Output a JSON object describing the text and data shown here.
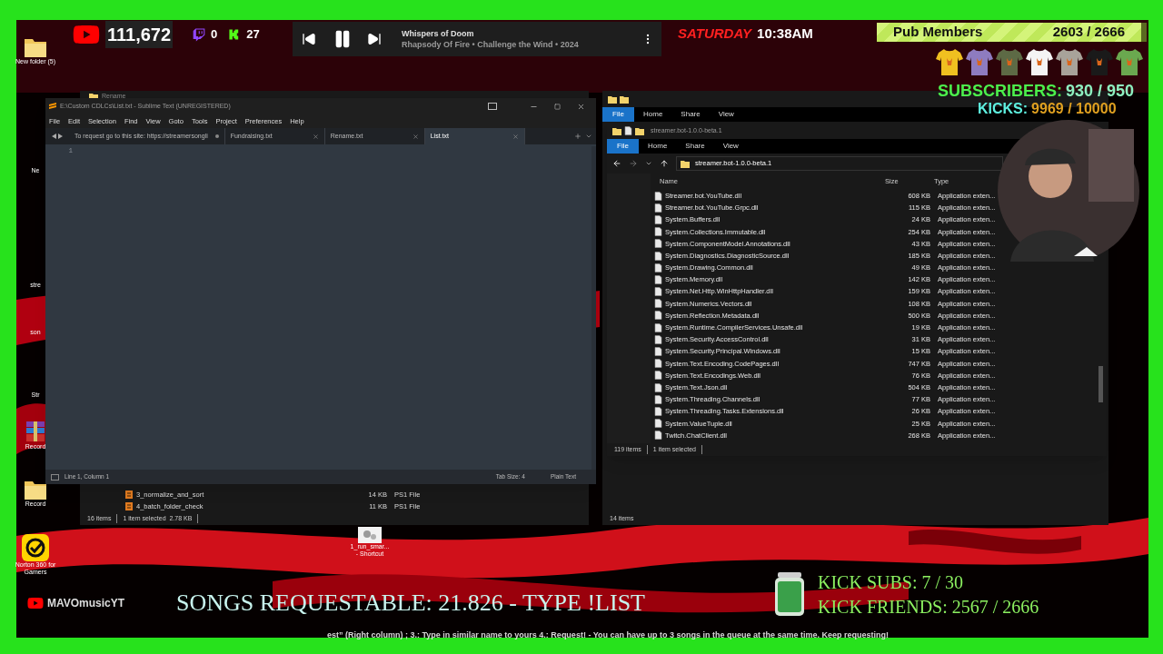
{
  "overlay_top": {
    "youtube_count": "111,672",
    "twitch_count": "0",
    "kick_count": "27",
    "now_playing": {
      "title": "Whispers of Doom",
      "subtitle": "Rhapsody Of Fire • Challenge the Wind • 2024",
      "playing": true
    },
    "day": "SATURDAY",
    "time": "10:38AM",
    "pub_members": {
      "label": "Pub Members",
      "count": "2603 / 2666",
      "level": 0.98
    },
    "shirts": [
      {
        "color": "#f0c020"
      },
      {
        "color": "#8e7cc0"
      },
      {
        "color": "#5d6a45"
      },
      {
        "color": "#f4f4f4"
      },
      {
        "color": "#a8a39a"
      },
      {
        "color": "#1a1a1a"
      },
      {
        "color": "#6aa84f"
      }
    ],
    "subscribers": {
      "label": "SUBSCRIBERS:",
      "count": "930 / 950"
    },
    "kicks": {
      "label": "KICKS:",
      "count": "9969 / 10000"
    }
  },
  "desktop_icons": [
    {
      "label": "New folder (5)",
      "kind": "folder"
    },
    {
      "label": "Ne",
      "kind": "partial"
    },
    {
      "label": "stre",
      "kind": "partial"
    },
    {
      "label": "son",
      "kind": "partial"
    },
    {
      "label": "Str",
      "kind": "partial"
    },
    {
      "label": "Record",
      "kind": "archive"
    },
    {
      "label": "Record",
      "kind": "folder"
    },
    {
      "label": "Norton 360 for Gamers",
      "kind": "norton"
    }
  ],
  "shortcut": {
    "label": "1_run_smar... - Shortcut"
  },
  "rename_window": {
    "title": "Rename",
    "rows": [
      {
        "name": "3_normalize_and_sort",
        "size": "14 KB",
        "type": "PS1 File"
      },
      {
        "name": "4_batch_folder_check",
        "size": "11 KB",
        "type": "PS1 File"
      }
    ],
    "status": [
      "16 items",
      "1 item selected  2.78 KB"
    ]
  },
  "sublime": {
    "title": "E:\\Custom CDLCs\\List.txt - Sublime Text (UNREGISTERED)",
    "menu": [
      "File",
      "Edit",
      "Selection",
      "Find",
      "View",
      "Goto",
      "Tools",
      "Project",
      "Preferences",
      "Help"
    ],
    "tabs": [
      {
        "label": "To request go to this site: https://streamersongli",
        "selected": false,
        "dirty": true
      },
      {
        "label": "Fundraising.txt",
        "selected": false,
        "dirty": false
      },
      {
        "label": "Rename.txt",
        "selected": false,
        "dirty": false
      },
      {
        "label": "List.txt",
        "selected": true,
        "dirty": false
      }
    ],
    "line_numbers": [
      "1"
    ],
    "status": "Line 1, Column 1",
    "tab_size": "Tab Size: 4",
    "syntax": "Plain Text"
  },
  "explorer_back": {
    "ribbon": [
      {
        "label": "File",
        "selected": true
      },
      {
        "label": "Home",
        "selected": false
      },
      {
        "label": "Share",
        "selected": false
      },
      {
        "label": "View",
        "selected": false
      }
    ],
    "status": "14 items"
  },
  "explorer": {
    "title": "streamer.bot-1.0.0-beta.1",
    "ribbon": [
      {
        "label": "File",
        "selected": true
      },
      {
        "label": "Home",
        "selected": false
      },
      {
        "label": "Share",
        "selected": false
      },
      {
        "label": "View",
        "selected": false
      }
    ],
    "path": "streamer.bot-1.0.0-beta.1",
    "columns": [
      "Name",
      "Size",
      "Type"
    ],
    "rows": [
      {
        "name": "Streamer.bot.YouTube.dll",
        "size": "608 KB",
        "type": "Application exten..."
      },
      {
        "name": "Streamer.bot.YouTube.Grpc.dll",
        "size": "115 KB",
        "type": "Application exten..."
      },
      {
        "name": "System.Buffers.dll",
        "size": "24 KB",
        "type": "Application exten..."
      },
      {
        "name": "System.Collections.Immutable.dll",
        "size": "254 KB",
        "type": "Application exten..."
      },
      {
        "name": "System.ComponentModel.Annotations.dll",
        "size": "43 KB",
        "type": "Application exten..."
      },
      {
        "name": "System.Diagnostics.DiagnosticSource.dll",
        "size": "185 KB",
        "type": "Application exten..."
      },
      {
        "name": "System.Drawing.Common.dll",
        "size": "49 KB",
        "type": "Application exten..."
      },
      {
        "name": "System.Memory.dll",
        "size": "142 KB",
        "type": "Application exten..."
      },
      {
        "name": "System.Net.Http.WinHttpHandler.dll",
        "size": "159 KB",
        "type": "Application exten..."
      },
      {
        "name": "System.Numerics.Vectors.dll",
        "size": "108 KB",
        "type": "Application exten..."
      },
      {
        "name": "System.Reflection.Metadata.dll",
        "size": "500 KB",
        "type": "Application exten..."
      },
      {
        "name": "System.Runtime.CompilerServices.Unsafe.dll",
        "size": "19 KB",
        "type": "Application exten..."
      },
      {
        "name": "System.Security.AccessControl.dll",
        "size": "31 KB",
        "type": "Application exten..."
      },
      {
        "name": "System.Security.Principal.Windows.dll",
        "size": "15 KB",
        "type": "Application exten..."
      },
      {
        "name": "System.Text.Encoding.CodePages.dll",
        "size": "747 KB",
        "type": "Application exten..."
      },
      {
        "name": "System.Text.Encodings.Web.dll",
        "size": "76 KB",
        "type": "Application exten..."
      },
      {
        "name": "System.Text.Json.dll",
        "size": "504 KB",
        "type": "Application exten..."
      },
      {
        "name": "System.Threading.Channels.dll",
        "size": "77 KB",
        "type": "Application exten..."
      },
      {
        "name": "System.Threading.Tasks.Extensions.dll",
        "size": "26 KB",
        "type": "Application exten..."
      },
      {
        "name": "System.ValueTuple.dll",
        "size": "25 KB",
        "type": "Application exten..."
      },
      {
        "name": "Twitch.ChatClient.dll",
        "size": "268 KB",
        "type": "Application exten..."
      }
    ],
    "status": [
      "119 items",
      "1 item selected"
    ]
  },
  "overlay_bottom": {
    "channel": "MAVOmusicYT",
    "songs": "SONGS REQUESTABLE: 21.826 - TYPE !LIST",
    "kick_subs": "KICK SUBS: 7 / 30",
    "kick_friends": "KICK FRIENDS: 2567 / 2666",
    "ticker": "est” (Right column) ; 3.: Type in similar name to yours 4.: Request! - You can have up to 3 songs in the queue at the same time. Keep requesting!"
  }
}
